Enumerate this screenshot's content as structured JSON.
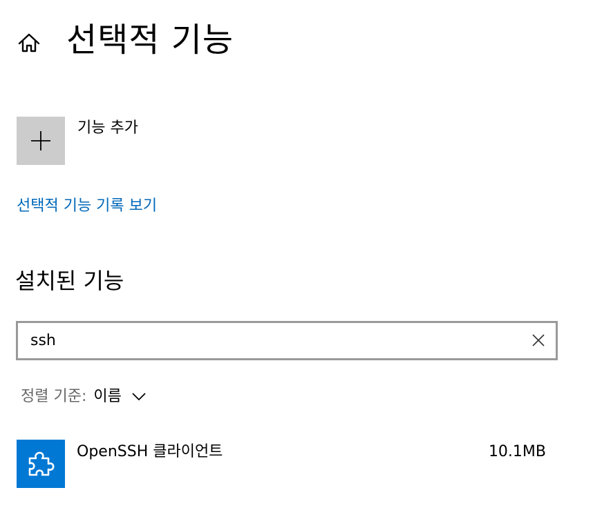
{
  "header": {
    "title": "선택적 기능",
    "home_icon": "home-icon"
  },
  "add_feature": {
    "label": "기능 추가",
    "icon": "plus-icon"
  },
  "history_link": {
    "label": "선택적 기능 기록 보기"
  },
  "installed": {
    "title": "설치된 기능",
    "search": {
      "value": "ssh",
      "placeholder": "",
      "clear_icon": "close-icon"
    },
    "sort": {
      "label": "정렬 기준:",
      "value": "이름",
      "icon": "chevron-down-icon"
    },
    "items": [
      {
        "name": "OpenSSH 클라이언트",
        "size": "10.1MB",
        "icon": "puzzle-icon"
      }
    ]
  },
  "colors": {
    "accent": "#0078d4",
    "link": "#0067b8",
    "tile_gray": "#cccccc",
    "border_gray": "#999999"
  }
}
